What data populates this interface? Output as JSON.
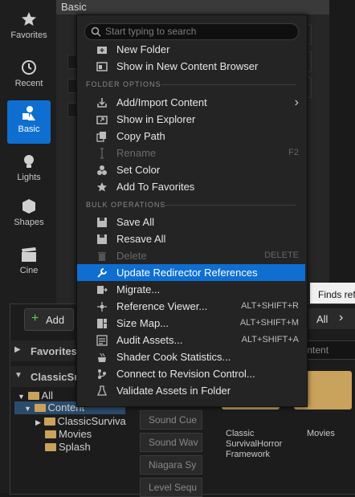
{
  "modebar": {
    "items": [
      {
        "label": "Favorites",
        "icon": "star-icon"
      },
      {
        "label": "Recent",
        "icon": "clock-icon"
      },
      {
        "label": "Basic",
        "icon": "shapes-icon"
      },
      {
        "label": "Lights",
        "icon": "lightbulb-icon"
      },
      {
        "label": "Shapes",
        "icon": "cube-icon"
      },
      {
        "label": "Cine",
        "icon": "clapper-icon"
      }
    ]
  },
  "basic_panel": {
    "title": "Basic"
  },
  "content_browser": {
    "add_label": "Add",
    "favorites_label": "Favorites",
    "project_label": "ClassicSu",
    "tree": [
      "All",
      "Content",
      "ClassicSurviva",
      "Movies",
      "Splash"
    ],
    "all_label": "All",
    "search_placeholder": "n Content",
    "filters": [
      "Sound Cue",
      "Sound Wav",
      "Niagara Sy",
      "Level Sequ"
    ],
    "tiles": [
      {
        "label": "Classic SurvivalHorror Framework"
      },
      {
        "label": "Movies"
      }
    ],
    "tooltip": "Finds ref"
  },
  "menu": {
    "search_placeholder": "Start typing to search",
    "section_folder": "FOLDER OPTIONS",
    "section_bulk": "BULK OPERATIONS",
    "items": [
      {
        "label": "New Folder",
        "icon": "new-folder-icon",
        "shortcut": ""
      },
      {
        "label": "Show in New Content Browser",
        "icon": "content-browser-icon",
        "shortcut": ""
      },
      {
        "label": "Add/Import Content",
        "icon": "import-icon",
        "shortcut": ""
      },
      {
        "label": "Show in Explorer",
        "icon": "explorer-icon",
        "shortcut": ""
      },
      {
        "label": "Copy Path",
        "icon": "copy-icon",
        "shortcut": ""
      },
      {
        "label": "Rename",
        "icon": "rename-icon",
        "shortcut": "F2"
      },
      {
        "label": "Set Color",
        "icon": "color-icon",
        "shortcut": ""
      },
      {
        "label": "Add To Favorites",
        "icon": "star-icon",
        "shortcut": ""
      },
      {
        "label": "Save All",
        "icon": "save-icon",
        "shortcut": ""
      },
      {
        "label": "Resave All",
        "icon": "save-icon",
        "shortcut": ""
      },
      {
        "label": "Delete",
        "icon": "trash-icon",
        "shortcut": "DELETE"
      },
      {
        "label": "Update Redirector References",
        "icon": "wrench-icon",
        "shortcut": ""
      },
      {
        "label": "Migrate...",
        "icon": "migrate-icon",
        "shortcut": ""
      },
      {
        "label": "Reference Viewer...",
        "icon": "reference-icon",
        "shortcut": "ALT+SHIFT+R"
      },
      {
        "label": "Size Map...",
        "icon": "sizemap-icon",
        "shortcut": "ALT+SHIFT+M"
      },
      {
        "label": "Audit Assets...",
        "icon": "audit-icon",
        "shortcut": "ALT+SHIFT+A"
      },
      {
        "label": "Shader Cook Statistics...",
        "icon": "shader-icon",
        "shortcut": ""
      },
      {
        "label": "Connect to Revision Control...",
        "icon": "revision-icon",
        "shortcut": ""
      },
      {
        "label": "Validate Assets in Folder",
        "icon": "validate-icon",
        "shortcut": ""
      }
    ]
  },
  "colors": {
    "accent": "#0e6fd1",
    "folder": "#c9a25b",
    "menu_bg": "#242424"
  }
}
